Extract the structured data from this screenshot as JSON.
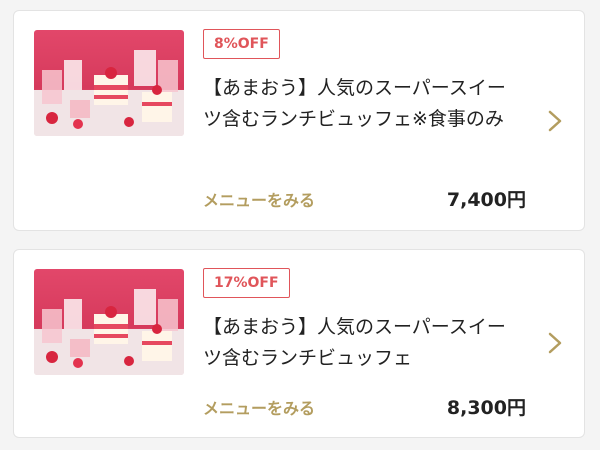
{
  "colors": {
    "badge_red": "#e0555a",
    "menu_gold": "#b39d5f",
    "chevron_gold": "#b39d5f",
    "image_pink": "#d9365c"
  },
  "plans": [
    {
      "discount": "8%OFF",
      "title": "【あまおう】人気のスーパースイーツ含むランチビュッフェ※食事のみ",
      "menu_link": "メニューをみる",
      "price": "7,400円",
      "thumbnail_icon": "strawberry-cakes-photo",
      "chevron_icon": "chevron-right-icon"
    },
    {
      "discount": "17%OFF",
      "title": "【あまおう】人気のスーパースイーツ含むランチビュッフェ",
      "menu_link": "メニューをみる",
      "price": "8,300円",
      "thumbnail_icon": "strawberry-cakes-photo",
      "chevron_icon": "chevron-right-icon"
    }
  ]
}
